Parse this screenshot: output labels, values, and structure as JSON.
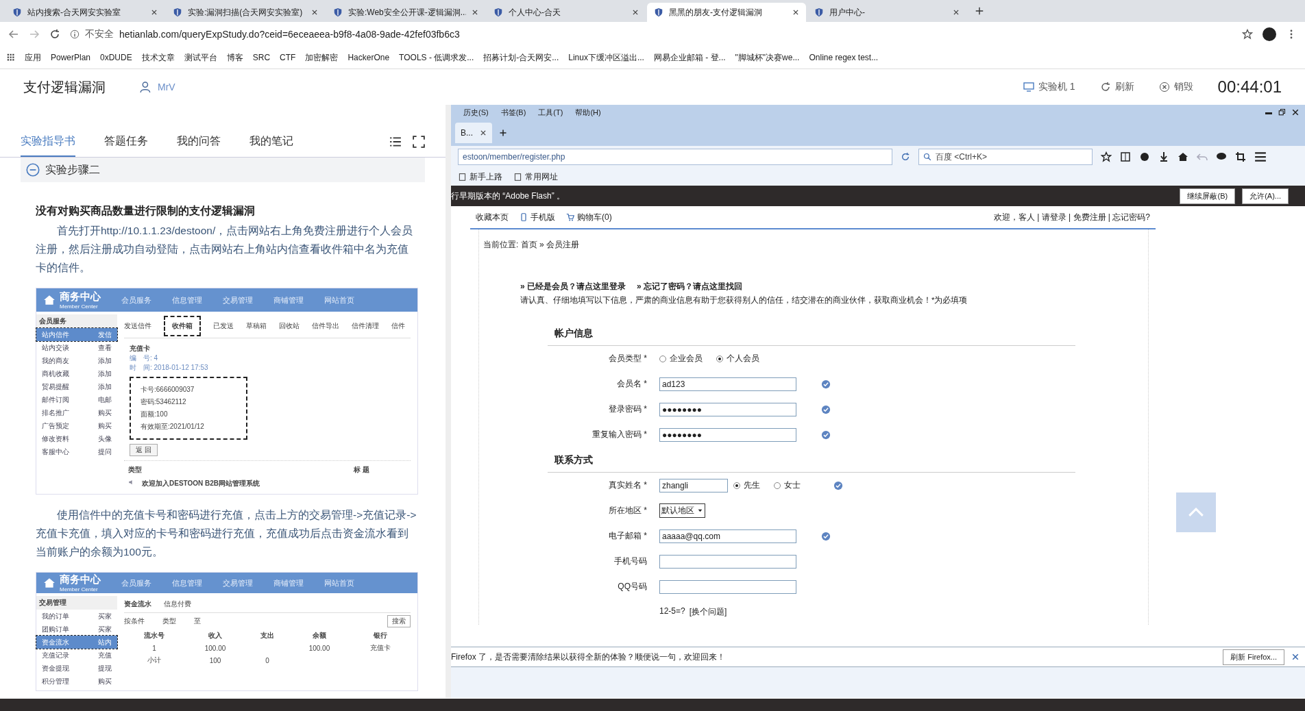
{
  "browser_tabs": [
    {
      "title": "站内搜索-合天网安实验室",
      "selected": false
    },
    {
      "title": "实验:漏洞扫描(合天网安实验室)",
      "selected": false
    },
    {
      "title": "实验:Web安全公开课-逻辑漏洞...",
      "selected": false
    },
    {
      "title": "个人中心-合天",
      "selected": false
    },
    {
      "title": "黑黑的朋友-支付逻辑漏洞",
      "selected": true
    },
    {
      "title": "用户中心-",
      "selected": false
    }
  ],
  "address_bar": {
    "security": "不安全",
    "url": "hetianlab.com/queryExpStudy.do?ceid=6eceaeea-b9f8-4a08-9ade-42fef03fb6c3"
  },
  "bookmarks": [
    "应用",
    "PowerPlan",
    "0xDUDE",
    "技术文章",
    "测试平台",
    "博客",
    "SRC",
    "CTF",
    "加密解密",
    "HackerOne",
    "TOOLS - 低调求发...",
    "招募计划-合天网安...",
    "Linux下缓冲区溢出...",
    "网易企业邮箱 - 登...",
    "\"脚城杯\"决赛we...",
    "Online regex test..."
  ],
  "lab_header": {
    "title": "支付逻辑漏洞",
    "user": "MrV",
    "actions": [
      "实验机 1",
      "刷新",
      "销毁"
    ],
    "timer": "00:44:01"
  },
  "guide": {
    "tabs": [
      {
        "label": "实验指导书",
        "selected": true
      },
      {
        "label": "答题任务",
        "selected": false
      },
      {
        "label": "我的问答",
        "selected": false
      },
      {
        "label": "我的笔记",
        "selected": false
      }
    ],
    "step": "实验步骤二",
    "heading": "没有对购买商品数量进行限制的支付逻辑漏洞",
    "paragraph_1": "首先打开http://10.1.1.23/destoon/，点击网站右上角免费注册进行个人会员注册，然后注册成功自动登陆，点击网站右上角站内信查看收件箱中名为充值卡的信件。",
    "screenshot_1": {
      "logo": "商务中心",
      "logo_sub": "Member Center",
      "nav": [
        "会员服务",
        "信息管理",
        "交易管理",
        "商铺管理",
        "网站首页"
      ],
      "sidebar_title": "会员服务",
      "sidebar": [
        {
          "label": "站内信件",
          "action": "发信",
          "selected": true
        },
        {
          "label": "站内交谈",
          "action": "查看",
          "selected": false
        },
        {
          "label": "我的商友",
          "action": "添加",
          "selected": false
        },
        {
          "label": "商机收藏",
          "action": "添加",
          "selected": false
        },
        {
          "label": "贸易提醒",
          "action": "添加",
          "selected": false
        },
        {
          "label": "邮件订阅",
          "action": "电邮",
          "selected": false
        },
        {
          "label": "排名推广",
          "action": "购买",
          "selected": false
        },
        {
          "label": "广告预定",
          "action": "购买",
          "selected": false
        },
        {
          "label": "修改资料",
          "action": "头像",
          "selected": false
        },
        {
          "label": "客服中心",
          "action": "提问",
          "selected": false
        }
      ],
      "tabs": [
        {
          "label": "发送信件",
          "selected": false
        },
        {
          "label": "收件箱",
          "selected": true
        },
        {
          "label": "已发送",
          "selected": false
        },
        {
          "label": "草稿箱",
          "selected": false
        },
        {
          "label": "回收站",
          "selected": false
        },
        {
          "label": "信件导出",
          "selected": false
        },
        {
          "label": "信件清理",
          "selected": false
        },
        {
          "label": "信件",
          "selected": false
        }
      ],
      "letter_title": "充值卡",
      "letter_meta": [
        "编　号: 4",
        "时　间: 2018-01-12 17:53"
      ],
      "card_lines": [
        "卡号:6666009037",
        "密码:53462112",
        "面额:100",
        "有效期至:2021/01/12"
      ],
      "back_button": "返 回",
      "list_columns": [
        "类型",
        "标 题"
      ],
      "list_row": "欢迎加入DESTOON B2B网站管理系统"
    },
    "paragraph_2": "使用信件中的充值卡号和密码进行充值，点击上方的交易管理->充值记录->充值卡充值，填入对应的卡号和密码进行充值，充值成功后点击资金流水看到当前账户的余额为100元。",
    "screenshot_2": {
      "logo": "商务中心",
      "logo_sub": "Member Center",
      "nav": [
        "会员服务",
        "信息管理",
        "交易管理",
        "商铺管理",
        "网站首页"
      ],
      "sidebar_title": "交易管理",
      "sidebar": [
        {
          "label": "我的订单",
          "action": "买家",
          "selected": false
        },
        {
          "label": "团购订单",
          "action": "买家",
          "selected": false
        },
        {
          "label": "资金流水",
          "action": "站内",
          "selected": true
        },
        {
          "label": "充值记录",
          "action": "充值",
          "selected": false
        },
        {
          "label": "资金提现",
          "action": "提现",
          "selected": false
        },
        {
          "label": "积分管理",
          "action": "购买",
          "selected": false
        }
      ],
      "tabs": [
        {
          "label": "资金流水",
          "selected": true
        },
        {
          "label": "信息付费",
          "selected": false
        }
      ],
      "filters": [
        "按条件",
        "类型",
        "至"
      ],
      "search_button": "搜索",
      "columns": [
        "流水号",
        "收入",
        "支出",
        "余额",
        "银行"
      ],
      "rows": [
        [
          "1",
          "100.00",
          "",
          "100.00",
          "充值卡"
        ],
        [
          "小计",
          "100",
          "0",
          "",
          ""
        ]
      ]
    }
  },
  "remote_firefox": {
    "menu": [
      "历史(S)",
      "书签(B)",
      "工具(T)",
      "帮助(H)"
    ],
    "tab": "B...",
    "url": "estoon/member/register.php",
    "search_placeholder": "百度 <Ctrl+K>",
    "bookmarks": [
      "新手上路",
      "常用网址"
    ],
    "flash_bar": {
      "message": "行早期版本的 “Adobe Flash” 。",
      "buttons": [
        "继续屏蔽(B)",
        "允许(A)..."
      ]
    },
    "site": {
      "top_links": [
        "收藏本页",
        "手机版",
        "购物车(0)"
      ],
      "welcome": "欢迎，客人 | 请登录 | 免费注册 | 忘记密码?",
      "breadcrumb": "当前位置: 首页 » 会员注册",
      "member_links": [
        "» 已经是会员？请点这里登录",
        "» 忘记了密码？请点这里找回"
      ],
      "note": "请认真、仔细地填写以下信息，严肃的商业信息有助于您获得别人的信任，结交潜在的商业伙伴，获取商业机会！*为必填项",
      "sections": [
        {
          "title": "帐户信息",
          "rows": [
            {
              "kind": "radio",
              "label": "会员类型 *",
              "options": [
                {
                  "label": "企业会员",
                  "selected": false
                },
                {
                  "label": "个人会员",
                  "selected": true
                }
              ]
            },
            {
              "kind": "text",
              "label": "会员名 *",
              "value": "ad123",
              "valid": true
            },
            {
              "kind": "text",
              "label": "登录密码 *",
              "value": "●●●●●●●●",
              "valid": true
            },
            {
              "kind": "text",
              "label": "重复输入密码 *",
              "value": "●●●●●●●●",
              "valid": true
            }
          ]
        },
        {
          "title": "联系方式",
          "rows": [
            {
              "kind": "name",
              "label": "真实姓名 *",
              "value": "zhangli",
              "valid": true,
              "options": [
                {
                  "label": "先生",
                  "selected": true
                },
                {
                  "label": "女士",
                  "selected": false
                }
              ]
            },
            {
              "kind": "select",
              "label": "所在地区 *",
              "value": "默认地区"
            },
            {
              "kind": "text",
              "label": "电子邮箱 *",
              "value": "aaaaa@qq.com",
              "valid": true
            },
            {
              "kind": "text",
              "label": "手机号码",
              "valid": false
            },
            {
              "kind": "text",
              "label": "QQ号码",
              "valid": false
            },
            {
              "kind": "captcha",
              "value": "12-5=?",
              "link": "[换个问题]"
            }
          ]
        }
      ]
    },
    "notification": {
      "message": "Firefox 了，是否需要清除结果以获得全新的体验？顺便说一句，欢迎回来！",
      "button": "刷新 Firefox..."
    }
  }
}
